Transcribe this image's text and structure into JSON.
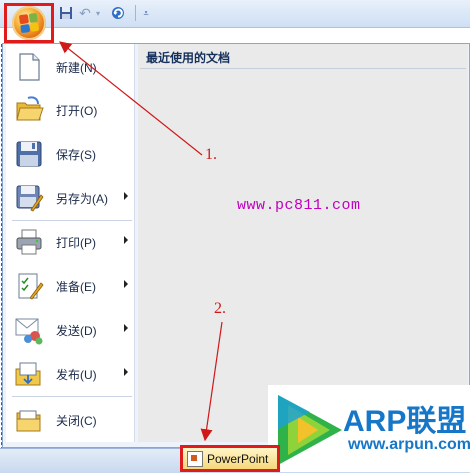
{
  "quick_access": {
    "office_button": "office-button",
    "icons": [
      "save-icon",
      "undo-icon",
      "redo-icon",
      "customize-icon"
    ]
  },
  "menu": {
    "items": [
      {
        "label": "新建(N)",
        "icon": "new-document-icon",
        "submenu": false
      },
      {
        "label": "打开(O)",
        "icon": "open-folder-icon",
        "submenu": false
      },
      {
        "label": "保存(S)",
        "icon": "save-floppy-icon",
        "submenu": false
      },
      {
        "label": "另存为(A)",
        "icon": "save-as-icon",
        "submenu": true
      },
      {
        "label": "打印(P)",
        "icon": "printer-icon",
        "submenu": true
      },
      {
        "label": "准备(E)",
        "icon": "prepare-icon",
        "submenu": true
      },
      {
        "label": "发送(D)",
        "icon": "send-icon",
        "submenu": true
      },
      {
        "label": "发布(U)",
        "icon": "publish-icon",
        "submenu": true
      },
      {
        "label": "关闭(C)",
        "icon": "close-folder-icon",
        "submenu": false
      }
    ],
    "recent_title": "最近使用的文档"
  },
  "taskbar": {
    "app_button": "PowerPoint"
  },
  "annotations": {
    "step1": "1.",
    "step2": "2.",
    "watermark": "www.pc811.com"
  },
  "logo": {
    "name": "ARP联盟",
    "url": "www.arpun.com"
  },
  "colors": {
    "annotation_red": "#d01818",
    "watermark_magenta": "#c000c0",
    "logo_blue": "#1677c8"
  }
}
